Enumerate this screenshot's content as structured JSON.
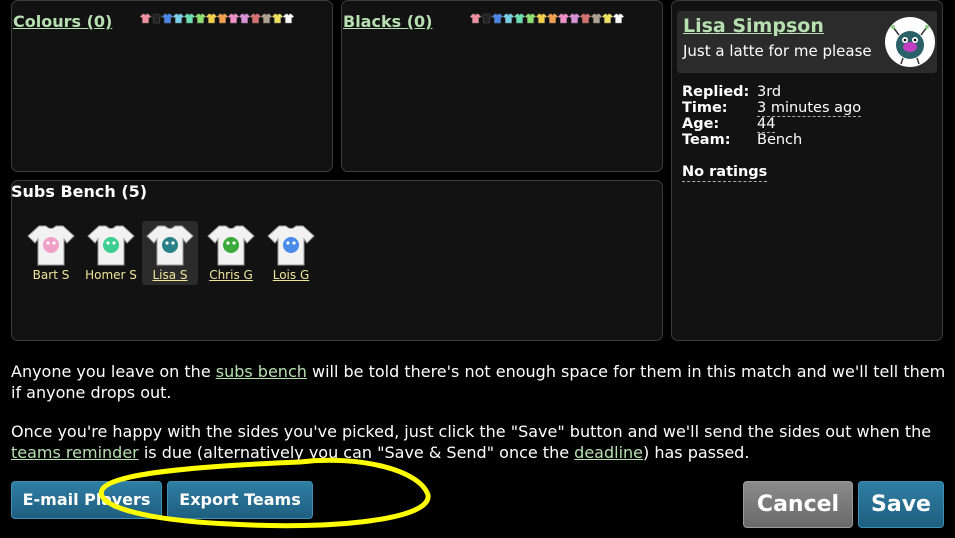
{
  "teams": [
    {
      "title": "Colours (0)",
      "shirt_colors": [
        "#f08fa0",
        "#222222",
        "#4a86e8",
        "#7ad0e8",
        "#6ae0b0",
        "#8ee070",
        "#f2d04a",
        "#f2a050",
        "#f08fc8",
        "#d890d8",
        "#d87070",
        "#b0a090",
        "#f0e060",
        "#ffffff"
      ]
    },
    {
      "title": "Blacks (0)",
      "shirt_colors": [
        "#f08fa0",
        "#222222",
        "#4a86e8",
        "#7ad0e8",
        "#6ae0b0",
        "#8ee070",
        "#f2d04a",
        "#f2a050",
        "#f08fc8",
        "#d890d8",
        "#d87070",
        "#b0a090",
        "#f0e060",
        "#ffffff"
      ]
    }
  ],
  "subs": {
    "title": "Subs Bench (5)",
    "players": [
      {
        "name": "Bart S",
        "icon": "pink-cat-shirt-icon",
        "color": "#f0a0c8",
        "linked": false,
        "selected": false
      },
      {
        "name": "Homer S",
        "icon": "green-bug-shirt-icon",
        "color": "#3ccf90",
        "linked": false,
        "selected": false
      },
      {
        "name": "Lisa S",
        "icon": "teal-monster-shirt-icon",
        "color": "#2a8088",
        "linked": true,
        "selected": true
      },
      {
        "name": "Chris G",
        "icon": "green-robot-shirt-icon",
        "color": "#3aaa3a",
        "linked": true,
        "selected": false
      },
      {
        "name": "Lois G",
        "icon": "blue-creature-shirt-icon",
        "color": "#4a8ae8",
        "linked": true,
        "selected": false
      }
    ]
  },
  "profile": {
    "name": "Lisa Simpson",
    "message": "Just a latte for me please",
    "replied_label": "Replied:",
    "replied_value": "3rd",
    "time_label": "Time:",
    "time_value": "3 minutes ago",
    "age_label": "Age:",
    "age_value": "44",
    "team_label": "Team:",
    "team_value": "Bench",
    "ratings": "No ratings"
  },
  "info": {
    "p1_a": "Anyone you leave on the ",
    "p1_link": "subs bench",
    "p1_b": " will be told there's not enough space for them in this match and we'll tell them if anyone drops out.",
    "p2_a": "Once you're happy with the sides you've picked, just click the \"Save\" button and we'll send the sides out when the ",
    "p2_link1": "teams reminder",
    "p2_b": " is due (alternatively you can \"Save & Send\" once the ",
    "p2_link2": "deadline",
    "p2_c": ") has passed."
  },
  "buttons": {
    "email": "E-mail Players",
    "export": "Export Teams",
    "cancel": "Cancel",
    "save": "Save"
  },
  "colors": {
    "link_green": "#b6e0b0",
    "button_blue": "#2a7499",
    "highlight": "#ffff00"
  }
}
